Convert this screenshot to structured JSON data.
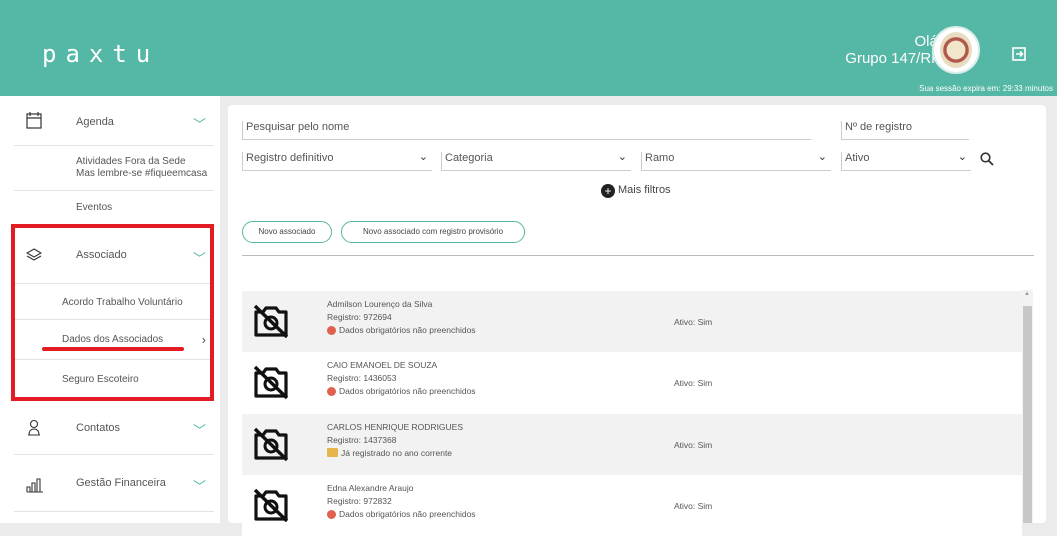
{
  "header": {
    "logo": "paxtu",
    "greeting_line1": "Olá,",
    "greeting_line2": "Grupo 147/RN",
    "session": "Sua sessão expira em: 29:33 minutos",
    "brand_color": "#55b7a5"
  },
  "sidebar": {
    "agenda": {
      "label": "Agenda",
      "icon": "calendar-icon"
    },
    "atividades": {
      "line1": "Atividades Fora da Sede",
      "line2": "Mas lembre-se #fiqueemcasa"
    },
    "eventos": {
      "label": "Eventos"
    },
    "associado": {
      "label": "Associado",
      "icon": "layers-icon"
    },
    "sub_items": [
      "Acordo Trabalho Voluntário",
      "Dados dos Associados",
      "Seguro Escoteiro"
    ],
    "contatos": {
      "label": "Contatos",
      "icon": "contact-icon"
    },
    "gestao": {
      "label": "Gestão Financeira",
      "icon": "bar-chart-icon"
    }
  },
  "filters": {
    "search_placeholder": "Pesquisar pelo nome",
    "registro_placeholder": "Nº de registro",
    "registro_definitivo": "Registro definitivo",
    "categoria": "Categoria",
    "ramo": "Ramo",
    "ativo": "Ativo",
    "mais_filtros": "Mais filtros"
  },
  "buttons": {
    "novo_associado": "Novo associado",
    "novo_provisorio": "Novo associado com registro provisório"
  },
  "members": [
    {
      "name": "Admilson Lourenço da Silva",
      "registro": "Registro: 972694",
      "status": "Dados obrigatórios não preenchidos",
      "status_icon": "warning",
      "active": "Ativo: Sim"
    },
    {
      "name": "CAIO EMANOEL DE SOUZA",
      "registro": "Registro: 1436053",
      "status": "Dados obrigatórios não preenchidos",
      "status_icon": "warning",
      "active": "Ativo: Sim"
    },
    {
      "name": "CARLOS HENRIQUE RODRIGUES",
      "registro": "Registro: 1437368",
      "status": "Já registrado no ano corrente",
      "status_icon": "registered",
      "active": "Ativo: Sim"
    },
    {
      "name": "Edna Alexandre Araujo",
      "registro": "Registro: 972832",
      "status": "Dados obrigatórios não preenchidos",
      "status_icon": "warning",
      "active": "Ativo: Sim"
    }
  ],
  "colors": {
    "accent": "#55b7a5",
    "highlight": "#e31b23",
    "active_bar": "#5dd3d5",
    "warning_dot": "#e0614e"
  }
}
